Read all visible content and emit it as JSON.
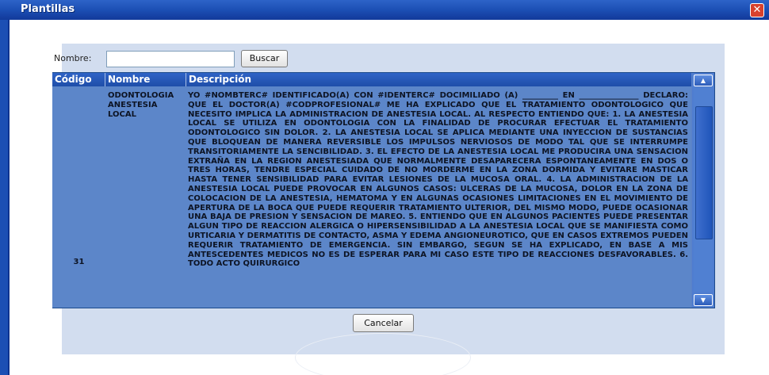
{
  "window": {
    "title": "Plantillas",
    "close_icon": "close-icon"
  },
  "search": {
    "label": "Nombre:",
    "value": "",
    "placeholder": "",
    "button_label": "Buscar"
  },
  "table": {
    "columns": [
      "Código",
      "Nombre",
      "Descripción"
    ],
    "rows": [
      {
        "codigo": "31",
        "nombre": "ODONTOLOGIA ANESTESIA LOCAL",
        "descripcion": "YO #NOMBTERC# IDENTIFICADO(A) CON #IDENTERC# DOCIMILIADO (A) _________ EN _______________ DECLARO: QUE EL DOCTOR(A) #CODPROFESIONAL# ME HA EXPLICADO QUE EL TRATAMIENTO ODONTOLOGICO QUE NECESITO IMPLICA LA ADMINISTRACION DE ANESTESIA LOCAL. AL RESPECTO ENTIENDO QUE: 1. LA ANESTESIA LOCAL SE UTILIZA EN ODONTOLOGIA CON LA FINALIDAD DE PROCURAR EFECTUAR EL TRATAMIENTO ODONTOLOGICO SIN DOLOR. 2. LA ANESTESIA LOCAL SE APLICA MEDIANTE UNA INYECCION DE SUSTANCIAS QUE BLOQUEAN DE MANERA REVERSIBLE LOS IMPULSOS NERVIOSOS DE MODO TAL QUE SE INTERRUMPE TRANSITORIAMENTE LA SENCIBILIDAD. 3. EL EFECTO DE LA ANESTESIA LOCAL ME PRODUCIRA UNA SENSACION EXTRAÑA EN LA REGION ANESTESIADA QUE NORMALMENTE DESAPARECERA ESPONTANEAMENTE EN DOS O TRES HORAS, TENDRE ESPECIAL CUIDADO DE NO MORDERME EN LA ZONA DORMIDA Y EVITARE MASTICAR HASTA TENER SENSIBILIDAD PARA EVITAR LESIONES DE LA MUCOSA ORAL. 4. LA ADMINISTRACION DE LA ANESTESIA LOCAL PUEDE PROVOCAR EN ALGUNOS CASOS: ULCERAS DE LA MUCOSA, DOLOR EN LA ZONA DE COLOCACION DE LA ANESTESIA, HEMATOMA Y EN ALGUNAS OCASIONES LIMITACIONES EN EL MOVIMIENTO DE APERTURA DE LA BOCA QUE PUEDE REQUERIR TRATAMIENTO ULTERIOR, DEL MISMO MODO, PUEDE OCASIONAR UNA BAJA DE PRESION Y SENSACION DE MAREO. 5. ENTIENDO QUE EN ALGUNOS PACIENTES PUEDE PRESENTAR ALGUN TIPO DE REACCION ALERGICA O HIPERSENSIBILIDAD A LA ANESTESIA LOCAL QUE SE MANIFIESTA COMO URTICARIA Y DERMATITIS DE CONTACTO, ASMA Y EDEMA ANGIONEUROTICO, QUE EN CASOS EXTREMOS PUEDEN REQUERIR TRATAMIENTO DE EMERGENCIA. SIN EMBARGO, SEGUN SE HA EXPLICADO, EN BASE A MIS ANTESCEDENTES MEDICOS NO ES DE ESPERAR PARA MI CASO ESTE TIPO DE REACCIONES DESFAVORABLES. 6. TODO ACTO QUIRURGICO"
      }
    ]
  },
  "footer": {
    "cancel_label": "Cancelar"
  },
  "colors": {
    "titlebar": "#1c4fb4",
    "panel": "#d2ddef",
    "grid_row": "#5c86c9",
    "header": "#2f63c6"
  },
  "icons": {
    "scroll_up": "chevron-up-icon",
    "scroll_down": "chevron-down-icon"
  }
}
